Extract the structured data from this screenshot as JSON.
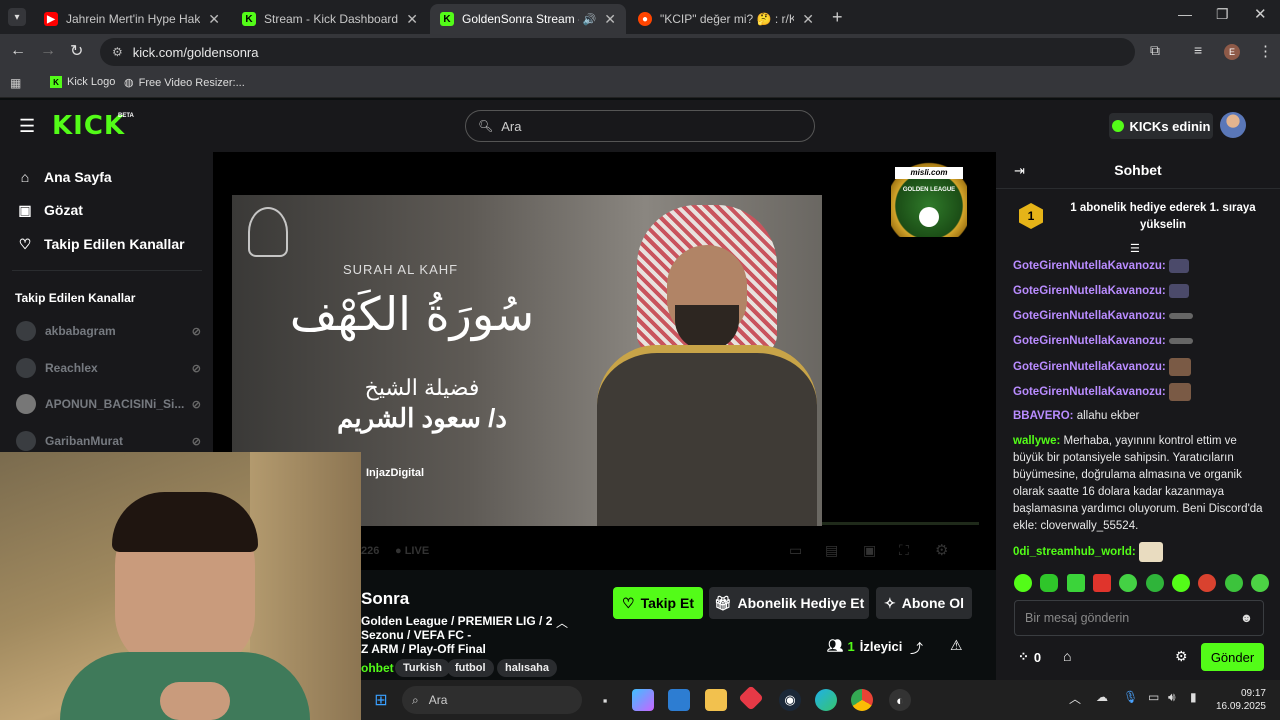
{
  "colors": {
    "brand": "#53fc18",
    "chat_user": "#b98cff",
    "chat_user2": "#b98cff",
    "page_bg": "#0b0e0f",
    "panel_bg": "#18181b"
  },
  "browser": {
    "tabs": [
      {
        "title": "Jahrein Mert'in Hype Hakkında",
        "icon": "youtube-icon"
      },
      {
        "title": "Stream - Kick Dashboard",
        "icon": "kick-icon"
      },
      {
        "title": "GoldenSonra Stream - Watch",
        "icon": "kick-icon"
      },
      {
        "title": "\"KCIP\" değer mi? 🤔 : r/KickStr",
        "icon": "reddit-icon"
      }
    ],
    "url": "kick.com/goldensonra",
    "profile_initial": "E",
    "bookmarks": [
      {
        "label": "Kick Logo"
      },
      {
        "label": "Free Video Resizer:..."
      }
    ]
  },
  "kick": {
    "logo": "KICK",
    "logo_badge": "BETA",
    "search_placeholder": "Ara",
    "kicks_button": "KICKs edinin"
  },
  "sidebar": {
    "nav": [
      {
        "label": "Ana Sayfa",
        "icon": "home-icon"
      },
      {
        "label": "Gözat",
        "icon": "browse-icon"
      },
      {
        "label": "Takip Edilen Kanallar",
        "icon": "heart-icon"
      }
    ],
    "section_title": "Takip Edilen Kanallar",
    "channels": [
      {
        "name": "akbabagram"
      },
      {
        "name": "Reachlex"
      },
      {
        "name": "APONUN_BACISINi_Si..."
      },
      {
        "name": "GaribanMurat"
      }
    ]
  },
  "player": {
    "sponsor_top": "misli.com",
    "sponsor_bottom": "GOLDEN LEAGUE",
    "video_text": {
      "surah": "SURAH AL KAHF",
      "title_ar": "سُورَةُ الكَهْف",
      "sub_ar1": "فضيلة الشيخ",
      "sub_ar2": "د/ سعود الشريم",
      "brand": "InjazDigital"
    },
    "viewers_partial": "226",
    "live_label": "LIVE"
  },
  "stream_info": {
    "channel_name": "Sonra",
    "title_lines": [
      "Golden League / PREMIER LIG / 2",
      "Sezonu / VEFA FC -",
      "Z ARM / Play-Off Final"
    ],
    "category_partial": "ohbet",
    "tags": [
      "Turkish",
      "futbol",
      "halısaha"
    ],
    "follow_button": "Takip Et",
    "gift_button": "Abonelik Hediye Et",
    "sub_button": "Abone Ol",
    "viewer_count": "1",
    "viewer_label": "İzleyici"
  },
  "chat": {
    "title": "Sohbet",
    "pinned_rank": "1",
    "pinned_text": "1 abonelik hediye ederek 1. sıraya yükselin",
    "messages": [
      {
        "user": "GoteGirenNutellaKavanozu:",
        "text": ""
      },
      {
        "user": "GoteGirenNutellaKavanozu:",
        "text": ""
      },
      {
        "user": "GoteGirenNutellaKavanozu:",
        "text": ""
      },
      {
        "user": "GoteGirenNutellaKavanozu:",
        "text": ""
      },
      {
        "user": "GoteGirenNutellaKavanozu:",
        "text": ""
      },
      {
        "user": "GoteGirenNutellaKavanozu:",
        "text": ""
      },
      {
        "user": "BBAVERO:",
        "text": "allahu ekber"
      },
      {
        "user": "wallywe:",
        "text": "Merhaba, yayınını kontrol ettim ve büyük bir potansiyele sahipsin. Yaratıcıların büyümesine, doğrulama almasına ve organik olarak saatte 16 dolara kadar kazanmaya başlamasına yardımcı oluyorum. Beni Discord'da ekle: cloverwally_55524."
      },
      {
        "user": "0di_streamhub_world:",
        "text": ""
      }
    ],
    "input_placeholder": "Bir mesaj gönderin",
    "points": "0",
    "send_button": "Gönder"
  },
  "taskbar": {
    "search": "Ara",
    "time": "09:17",
    "date": "16.09.2025"
  }
}
